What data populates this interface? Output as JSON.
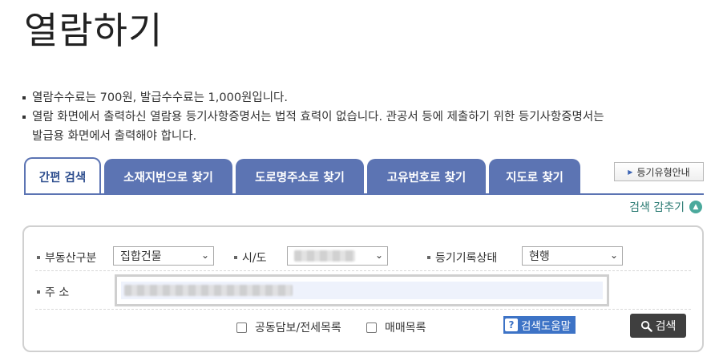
{
  "page": {
    "title": "열람하기"
  },
  "notices": [
    "열람수수료는 700원, 발급수수료는 1,000원입니다.",
    "열람 화면에서 출력하신 열람용 등기사항증명서는 법적 효력이 없습니다. 관공서 등에 제출하기 위한 등기사항증명서는",
    "발급용 화면에서 출력해야 합니다."
  ],
  "tabs": [
    {
      "label": "간편 검색",
      "active": true
    },
    {
      "label": "소재지번으로 찾기",
      "active": false
    },
    {
      "label": "도로명주소로 찾기",
      "active": false
    },
    {
      "label": "고유번호로 찾기",
      "active": false
    },
    {
      "label": "지도로 찾기",
      "active": false
    }
  ],
  "type_guide_button": {
    "label": "등기유형안내",
    "icon": "triangle-right-icon"
  },
  "collapse_link": {
    "label": "검색 감추기",
    "icon": "chevron-up-icon"
  },
  "form": {
    "property_type": {
      "label": "부동산구분",
      "value": "집합건물"
    },
    "region": {
      "label": "시/도",
      "value": ""
    },
    "record_status": {
      "label": "등기기록상태",
      "value": "현행"
    },
    "address": {
      "label": "주 소",
      "value": ""
    },
    "checkboxes": [
      {
        "label": "공동담보/전세목록",
        "checked": false
      },
      {
        "label": "매매목록",
        "checked": false
      }
    ],
    "help_button": {
      "label": "검색도움말",
      "icon": "question-icon"
    },
    "search_button": {
      "label": "검색",
      "icon": "magnifier-icon"
    }
  },
  "colors": {
    "tab_bg": "#5c74b3",
    "tab_active_text": "#2f4f8f",
    "help_bg": "#3d73c6",
    "search_bg": "#3f3f3f",
    "collapse_text": "#2a7a72"
  }
}
